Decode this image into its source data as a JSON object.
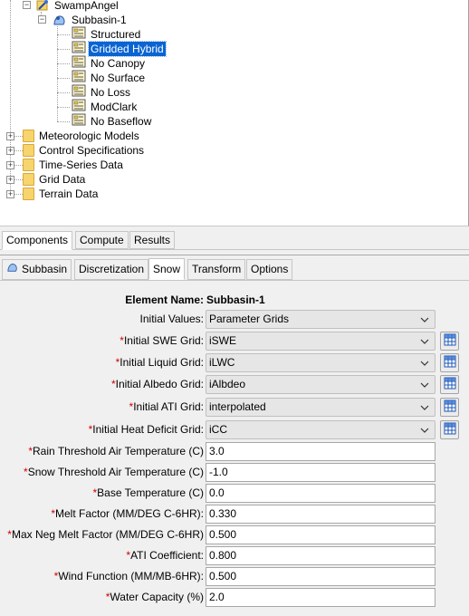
{
  "tree": {
    "root": "SwampAngel",
    "basin": "Subbasin-1",
    "methods": [
      "Structured",
      "Gridded Hybrid",
      "No Canopy",
      "No Surface",
      "No Loss",
      "ModClark",
      "No Baseflow"
    ],
    "selected_method": "Gridded Hybrid",
    "folders": [
      "Meteorologic Models",
      "Control Specifications",
      "Time-Series Data",
      "Grid Data",
      "Terrain Data"
    ]
  },
  "bottom_tabs": [
    "Components",
    "Compute",
    "Results"
  ],
  "editor_tabs": [
    "Subbasin",
    "Discretization",
    "Snow",
    "Transform",
    "Options"
  ],
  "form": {
    "element_name_label": "Element Name:",
    "element_name_value": "Subbasin-1",
    "initial_values_label": "Initial Values:",
    "initial_values_value": "Parameter Grids",
    "grids": [
      {
        "label": "Initial SWE Grid:",
        "value": "iSWE"
      },
      {
        "label": "Initial Liquid Grid:",
        "value": "iLWC"
      },
      {
        "label": "Initial Albedo Grid:",
        "value": "iAlbdeo"
      },
      {
        "label": "Initial ATI Grid:",
        "value": "interpolated"
      },
      {
        "label": "Initial Heat Deficit Grid:",
        "value": "iCC"
      }
    ],
    "fields": [
      {
        "label": "Rain Threshold Air Temperature (C)",
        "value": "3.0"
      },
      {
        "label": "Snow Threshold Air Temperature (C)",
        "value": "-1.0"
      },
      {
        "label": "Base Temperature (C)",
        "value": "0.0"
      },
      {
        "label": "Melt Factor (MM/DEG C-6HR):",
        "value": "0.330"
      },
      {
        "label": "Max Neg Melt Factor (MM/DEG C-6HR)",
        "value": "0.500"
      },
      {
        "label": "ATI Coefficient:",
        "value": "0.800"
      },
      {
        "label": "Wind Function (MM/MB-6HR):",
        "value": "0.500"
      },
      {
        "label": "Water Capacity (%)",
        "value": "2.0"
      }
    ],
    "required_mark": "*"
  },
  "colors": {
    "selection": "#0a64d2",
    "required": "#d00000",
    "folder": "#f7d46d"
  }
}
